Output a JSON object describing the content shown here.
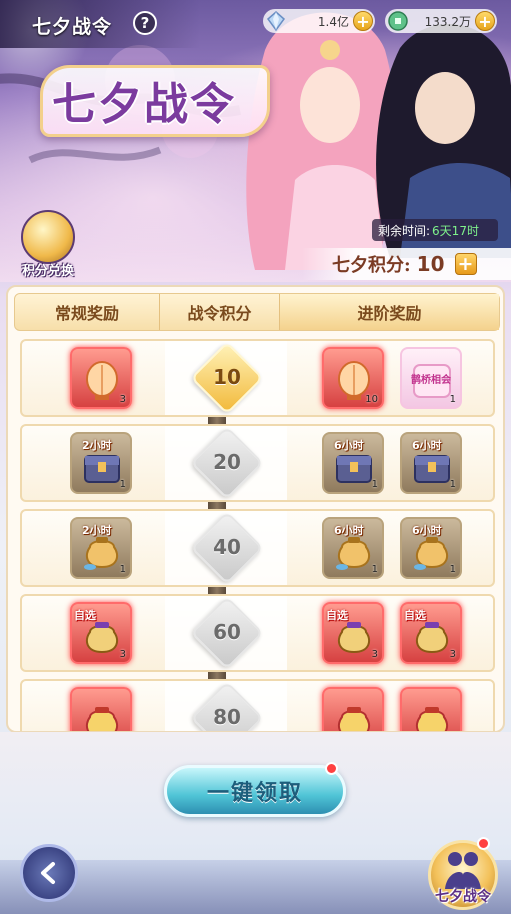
{
  "header": {
    "title": "七夕战令",
    "help_label": "?",
    "currencies": [
      {
        "icon": "diamond-icon",
        "value": "1.4亿"
      },
      {
        "icon": "jade-coin-icon",
        "value": "133.2万"
      }
    ]
  },
  "banner": {
    "logo_text": "七夕战令",
    "exchange_label": "积分兑换",
    "time_label": "剩余时间:",
    "time_value": "6天17时",
    "points_label": "七夕积分:",
    "points_value": "10"
  },
  "columns": [
    "常规奖励",
    "战令积分",
    "进阶奖励"
  ],
  "rows": [
    {
      "level": "10",
      "active": true,
      "normal": {
        "icon": "lantern-icon",
        "count": "3",
        "rarity": "red"
      },
      "advanced": [
        {
          "icon": "lantern-icon",
          "count": "10",
          "rarity": "red"
        },
        {
          "icon": "couple-card-icon",
          "count": "1",
          "rarity": "pink",
          "name": "鹊桥相会"
        }
      ]
    },
    {
      "level": "20",
      "active": false,
      "normal": {
        "icon": "chest-icon",
        "count": "1",
        "rarity": "gold",
        "tag": "2小时"
      },
      "advanced": [
        {
          "icon": "chest-icon",
          "count": "1",
          "rarity": "gold",
          "tag": "6小时"
        },
        {
          "icon": "chest-icon",
          "count": "1",
          "rarity": "gold",
          "tag": "6小时"
        }
      ]
    },
    {
      "level": "40",
      "active": false,
      "normal": {
        "icon": "money-bag-icon",
        "count": "1",
        "rarity": "gold",
        "tag": "2小时"
      },
      "advanced": [
        {
          "icon": "money-bag-icon",
          "count": "1",
          "rarity": "gold",
          "tag": "6小时"
        },
        {
          "icon": "money-bag-icon",
          "count": "1",
          "rarity": "gold",
          "tag": "6小时"
        }
      ]
    },
    {
      "level": "60",
      "active": false,
      "normal": {
        "icon": "selection-bag-icon",
        "count": "3",
        "rarity": "red",
        "tag": "自选"
      },
      "advanced": [
        {
          "icon": "selection-bag-icon",
          "count": "3",
          "rarity": "red",
          "tag": "自选"
        },
        {
          "icon": "selection-bag-icon",
          "count": "3",
          "rarity": "red",
          "tag": "自选"
        }
      ]
    },
    {
      "level": "80",
      "active": false,
      "normal": {
        "icon": "red-bag-icon",
        "count": "",
        "rarity": "red"
      },
      "advanced": [
        {
          "icon": "red-bag-icon",
          "count": "",
          "rarity": "red"
        },
        {
          "icon": "red-bag-icon",
          "count": "",
          "rarity": "red"
        }
      ]
    }
  ],
  "footer": {
    "claim_label": "一键领取",
    "fab_label": "七夕战令"
  },
  "colors": {
    "accent": "#7b3b9e",
    "active_level": "#f2b93a",
    "claim": "#4fc4d6"
  }
}
